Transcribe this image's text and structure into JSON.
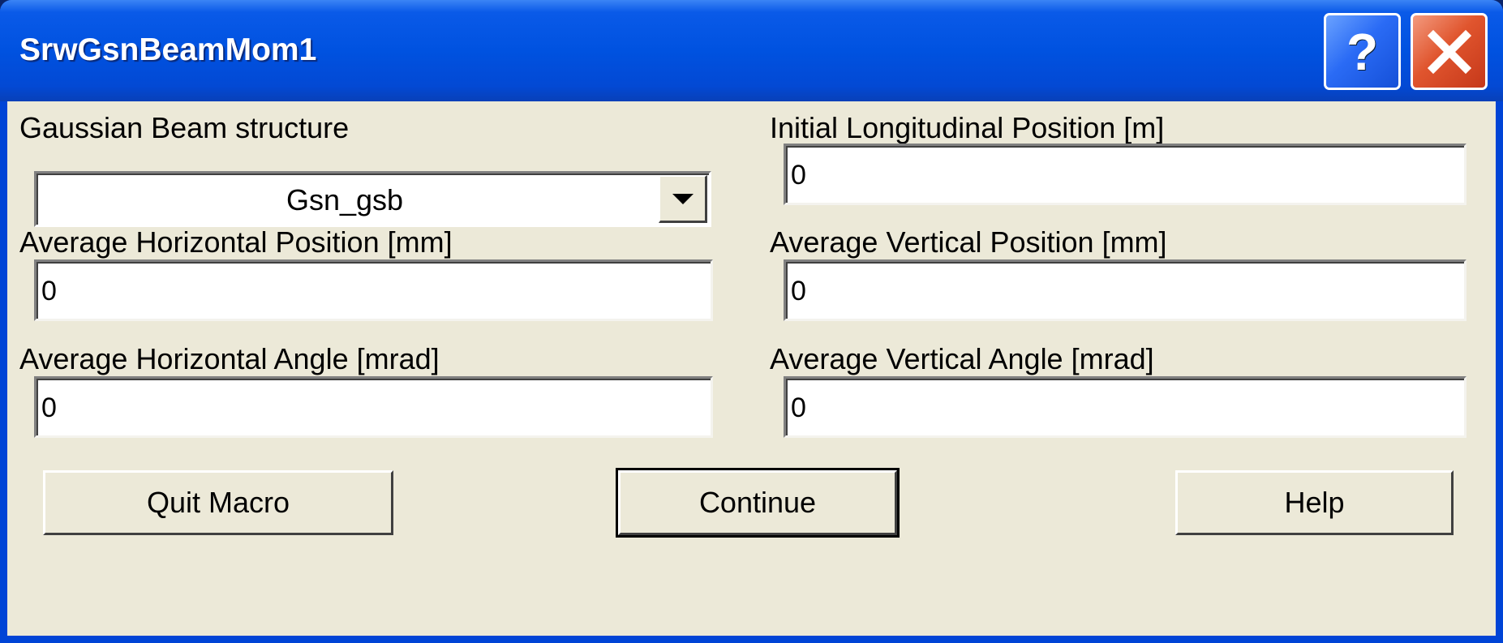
{
  "window": {
    "title": "SrwGsnBeamMom1"
  },
  "titlebar_buttons": {
    "help": "?",
    "close": "close"
  },
  "left": {
    "beam_structure": {
      "label": "Gaussian Beam structure",
      "value": "Gsn_gsb"
    },
    "avg_horizontal_position": {
      "label": "Average Horizontal Position [mm]",
      "value": "0"
    },
    "avg_horizontal_angle": {
      "label": "Average Horizontal Angle [mrad]",
      "value": "0"
    }
  },
  "right": {
    "initial_longitudinal_position": {
      "label": "Initial Longitudinal Position [m]",
      "value": "0"
    },
    "avg_vertical_position": {
      "label": "Average Vertical Position [mm]",
      "value": "0"
    },
    "avg_vertical_angle": {
      "label": "Average Vertical Angle [mrad]",
      "value": "0"
    }
  },
  "buttons": {
    "quit": "Quit Macro",
    "continue": "Continue",
    "help": "Help"
  },
  "colors": {
    "titlebar": "#0052e0",
    "face": "#ece9d8",
    "close_button": "#e0552e",
    "help_button": "#2a6bf5"
  }
}
